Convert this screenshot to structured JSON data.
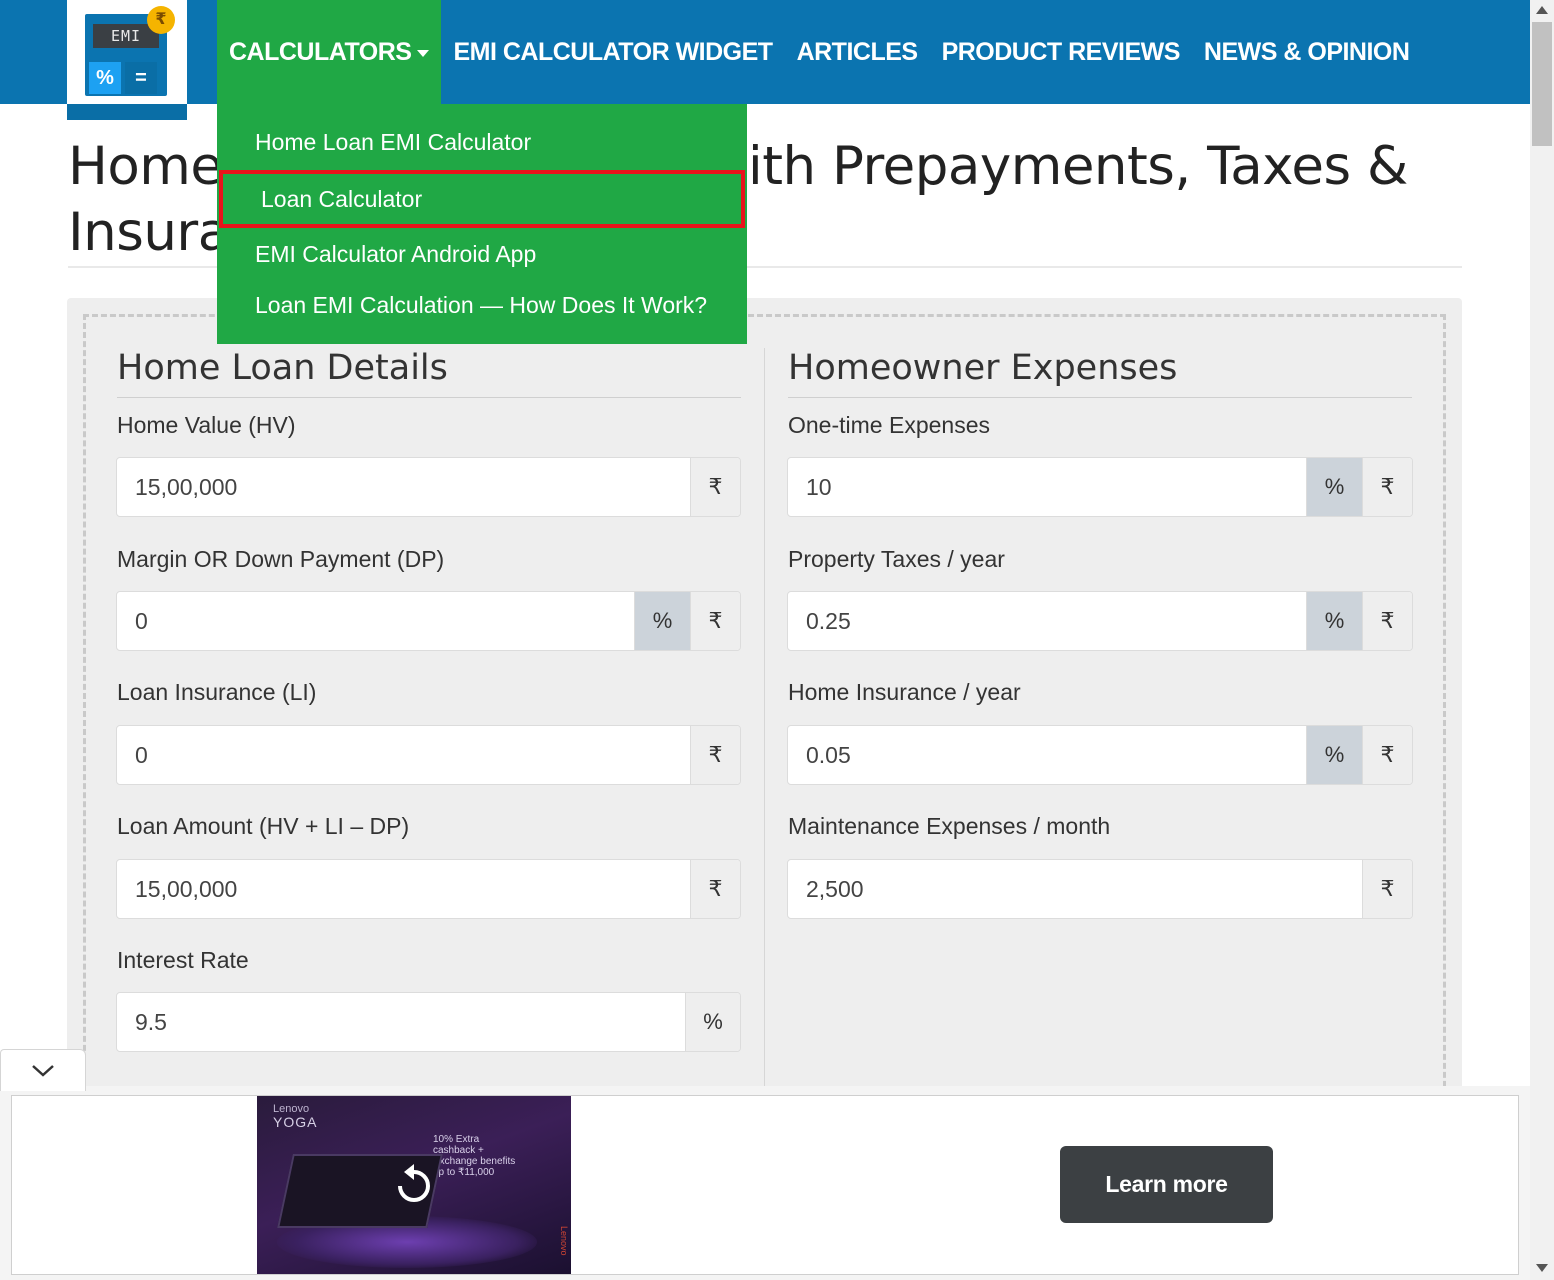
{
  "header": {
    "logo": {
      "screen_text": "EMI",
      "percent_key": "%",
      "equals_key": "=",
      "coin_symbol": "₹"
    },
    "nav": [
      {
        "label": "CALCULATORS"
      },
      {
        "label": "EMI CALCULATOR WIDGET"
      },
      {
        "label": "ARTICLES"
      },
      {
        "label": "PRODUCT REVIEWS"
      },
      {
        "label": "NEWS & OPINION"
      }
    ],
    "colors": {
      "bar": "#0b74b0",
      "active": "#20a845"
    }
  },
  "dropdown": {
    "items": [
      {
        "label": "Home Loan EMI Calculator"
      },
      {
        "label": "Loan Calculator"
      },
      {
        "label": "EMI Calculator Android App"
      },
      {
        "label": "Loan EMI Calculation — How Does It Work?"
      }
    ],
    "highlight_color": "#e8141b"
  },
  "page": {
    "title_left_1": "Home",
    "title_right_1": "ith Prepayments, Taxes &",
    "title_left_2": "Insura"
  },
  "loan_details": {
    "heading": "Home Loan Details",
    "fields": {
      "home_value": {
        "label": "Home Value (HV)",
        "value": "15,00,000",
        "addons": [
          "₹"
        ]
      },
      "down_payment": {
        "label": "Margin OR Down Payment (DP)",
        "value": "0",
        "addons": [
          "%",
          "₹"
        ],
        "selected_unit": "%"
      },
      "loan_insurance": {
        "label": "Loan Insurance (LI)",
        "value": "0",
        "addons": [
          "₹"
        ]
      },
      "loan_amount": {
        "label": "Loan Amount (HV + LI – DP)",
        "value": "15,00,000",
        "addons": [
          "₹"
        ]
      },
      "interest_rate": {
        "label": "Interest Rate",
        "value": "9.5",
        "addons": [
          "%"
        ]
      }
    }
  },
  "expenses": {
    "heading": "Homeowner Expenses",
    "fields": {
      "one_time": {
        "label": "One-time Expenses",
        "value": "10",
        "addons": [
          "%",
          "₹"
        ],
        "selected_unit": "%"
      },
      "property_taxes": {
        "label": "Property Taxes / year",
        "value": "0.25",
        "addons": [
          "%",
          "₹"
        ],
        "selected_unit": "%"
      },
      "home_insurance": {
        "label": "Home Insurance / year",
        "value": "0.05",
        "addons": [
          "%",
          "₹"
        ],
        "selected_unit": "%"
      },
      "maintenance": {
        "label": "Maintenance Expenses / month",
        "value": "2,500",
        "addons": [
          "₹"
        ]
      }
    }
  },
  "ad": {
    "brand_small": "Lenovo",
    "brand": "YOGA",
    "offer": "10% Extra cashback + Exchange benefits up to ₹11,000",
    "side_text": "Lenovo",
    "cta": "Learn more"
  }
}
